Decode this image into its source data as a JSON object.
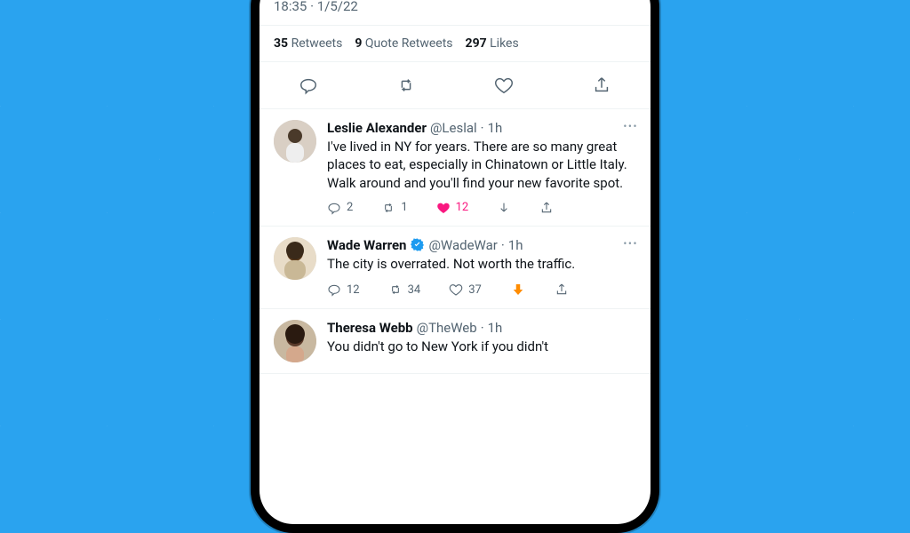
{
  "tweet_detail": {
    "timestamp": "18:35 · 1/5/22",
    "stats": {
      "retweets_count": "35",
      "retweets_label": "Retweets",
      "quotes_count": "9",
      "quotes_label": "Quote Retweets",
      "likes_count": "297",
      "likes_label": "Likes"
    }
  },
  "replies": [
    {
      "display_name": "Leslie Alexander",
      "handle": "@Leslal",
      "verified": false,
      "age": "1h",
      "text": "I've lived in NY for years. There are so many great places to eat, especially in Chinatown or Little Italy. Walk around and you'll find your new favorite spot.",
      "actions": {
        "replies": "2",
        "retweets": "1",
        "likes": "12",
        "liked": true,
        "downvoted": false
      }
    },
    {
      "display_name": "Wade Warren",
      "handle": "@WadeWar",
      "verified": true,
      "age": "1h",
      "text": "The city is overrated. Not worth the traffic.",
      "actions": {
        "replies": "12",
        "retweets": "34",
        "likes": "37",
        "liked": false,
        "downvoted": true
      }
    },
    {
      "display_name": "Theresa Webb",
      "handle": "@TheWeb",
      "verified": false,
      "age": "1h",
      "text": "You didn't go to New York if you didn't"
    }
  ],
  "colors": {
    "background": "#2aa3ef",
    "like_active": "#f91880",
    "downvote_active": "#ff8c00"
  }
}
